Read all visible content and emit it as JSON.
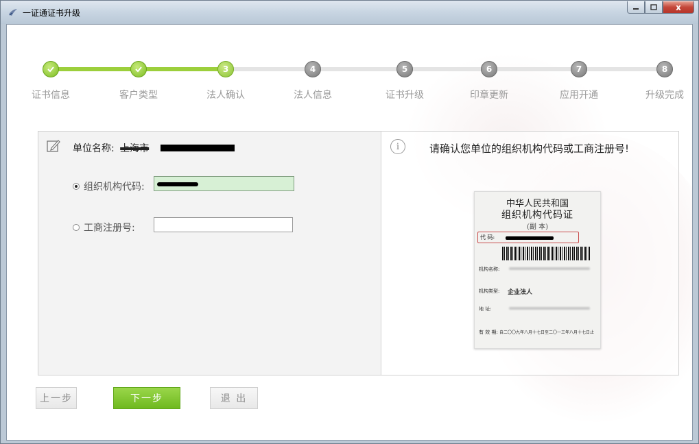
{
  "window": {
    "title": "一证通证书升级",
    "close_glyph": "x"
  },
  "steps": [
    {
      "number": "1",
      "label": "证书信息",
      "state": "done"
    },
    {
      "number": "2",
      "label": "客户类型",
      "state": "done"
    },
    {
      "number": "3",
      "label": "法人确认",
      "state": "current"
    },
    {
      "number": "4",
      "label": "法人信息",
      "state": "todo"
    },
    {
      "number": "5",
      "label": "证书升级",
      "state": "todo"
    },
    {
      "number": "6",
      "label": "印章更新",
      "state": "todo"
    },
    {
      "number": "7",
      "label": "应用开通",
      "state": "todo"
    },
    {
      "number": "8",
      "label": "升级完成",
      "state": "todo"
    }
  ],
  "form": {
    "unit_label": "单位名称:",
    "unit_value_prefix": "上海市",
    "org_code_label": "组织机构代码:",
    "org_code_selected": true,
    "biz_reg_label": "工商注册号:",
    "biz_reg_selected": false
  },
  "hint": {
    "text": "请确认您单位的组织机构代码或工商注册号!"
  },
  "certificate": {
    "title_line1": "中华人民共和国",
    "title_line2": "组织机构代码证",
    "subtitle": "(副 本)",
    "code_label": "代    码:",
    "org_name_label": "机构名称:",
    "org_type_label": "机构类型:",
    "org_type_value": "企业法人",
    "address_label": "地    址:",
    "validity_label": "有  效  期:",
    "validity_value": "自二〇〇九年八月十七日至二〇一三年八月十七日止"
  },
  "buttons": {
    "prev": "上一步",
    "next": "下一步",
    "exit": "退 出"
  },
  "colors": {
    "accent_green": "#8cc434",
    "inactive_step": "#7a7a7a",
    "highlight_field": "#d7f0d5"
  }
}
